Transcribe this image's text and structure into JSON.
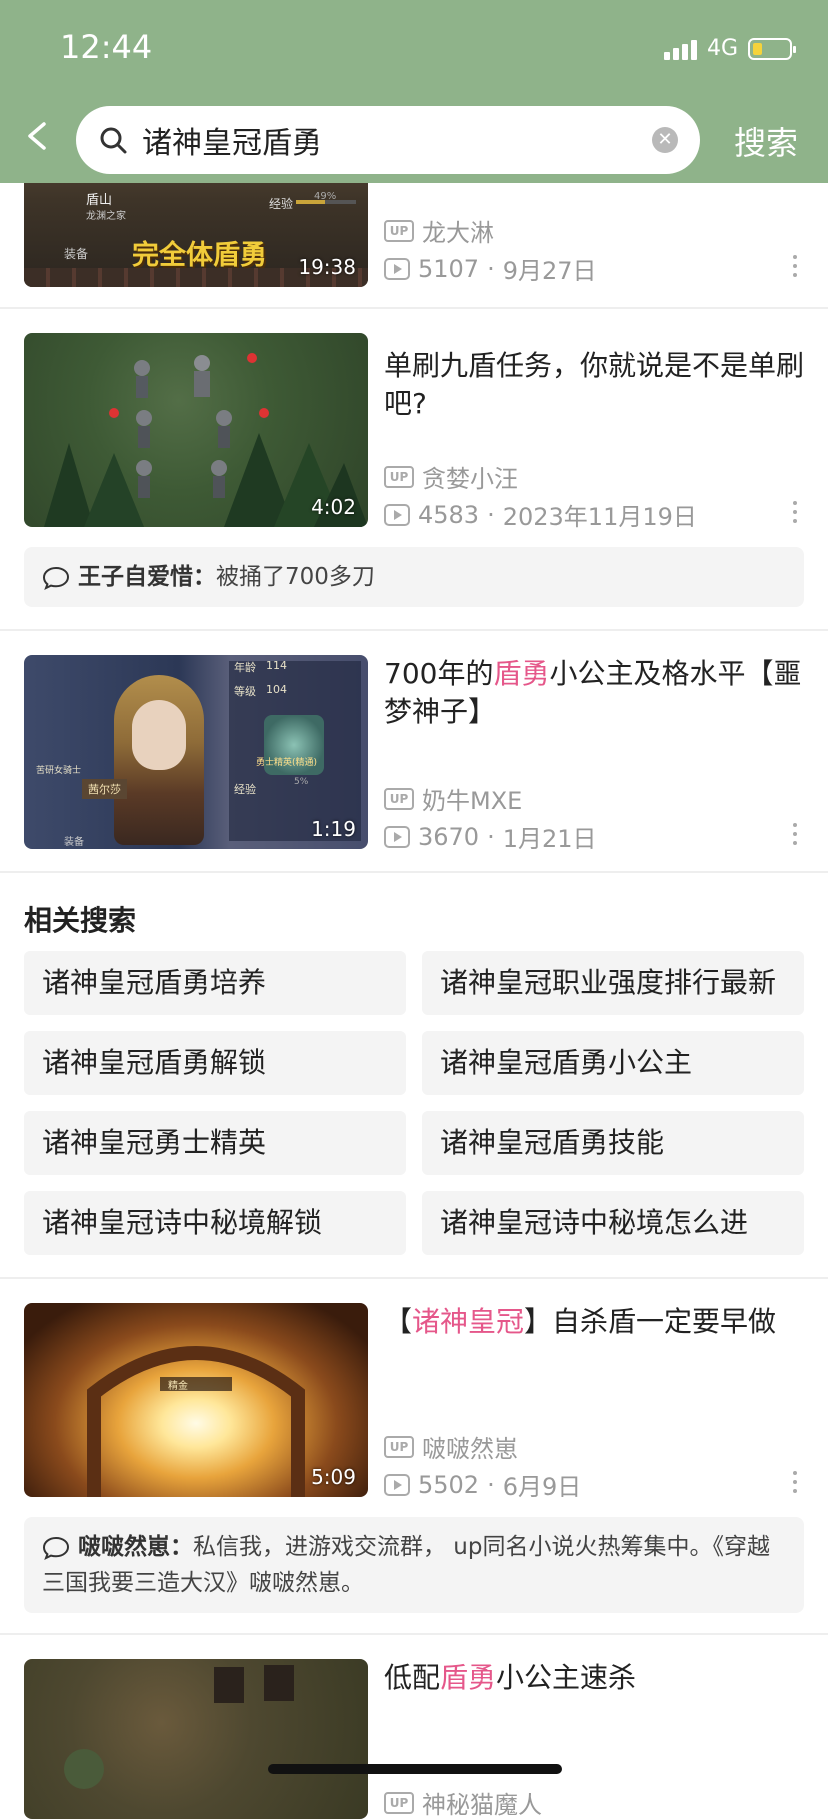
{
  "status_bar": {
    "time": "12:44",
    "network": "4G",
    "battery_level": 0.25
  },
  "search": {
    "query": "诸神皇冠盾勇",
    "clear_icon": "clear-icon",
    "search_label": "搜索",
    "back_icon": "chevron-left-icon"
  },
  "videos": [
    {
      "title_parts": [],
      "author": "龙大淋",
      "views": "5107",
      "date": "9月27日",
      "duration": "19:38",
      "thumb_overlay_text": "完全体盾勇",
      "thumb_labels": [
        "盾山",
        "龙渊之家",
        "经验",
        "49%",
        "装备"
      ]
    },
    {
      "title_parts": [
        {
          "text": "单刷九盾任务，你就说是不是单刷吧?",
          "hl": false
        }
      ],
      "author": "贪婪小汪",
      "views": "4583",
      "date": "2023年11月19日",
      "duration": "4:02",
      "comment": {
        "name": "王子自爱惜",
        "sep": "：",
        "text": "被捅了700多刀"
      }
    },
    {
      "title_parts": [
        {
          "text": "700年的",
          "hl": false
        },
        {
          "text": "盾勇",
          "hl": true
        },
        {
          "text": "小公主及格水平【噩梦神子】",
          "hl": false
        }
      ],
      "author": "奶牛MXE",
      "views": "3670",
      "date": "1月21日",
      "duration": "1:19",
      "thumb_labels": [
        "年龄",
        "114",
        "等级",
        "104",
        "勇士精英(精通)",
        "经验",
        "5%",
        "苦研女骑士",
        "茜尔莎",
        "装备"
      ]
    },
    {
      "title_parts": [
        {
          "text": "【",
          "hl": false
        },
        {
          "text": "诸神皇冠",
          "hl": true
        },
        {
          "text": "】自杀盾一定要早做",
          "hl": false
        }
      ],
      "author": "啵啵然崽",
      "views": "5502",
      "date": "6月9日",
      "duration": "5:09",
      "thumb_labels": [
        "精金"
      ],
      "comment": {
        "name": "啵啵然崽",
        "sep": "：",
        "text": "私信我，进游戏交流群， up同名小说火热筹集中。《穿越三国我要三造大汉》啵啵然崽。"
      }
    },
    {
      "title_parts": [
        {
          "text": "低配",
          "hl": false
        },
        {
          "text": "盾勇",
          "hl": true
        },
        {
          "text": "小公主速杀",
          "hl": false
        }
      ],
      "author": "神秘猫魔人",
      "views": "",
      "date": "",
      "duration": ""
    }
  ],
  "related": {
    "title": "相关搜索",
    "items": [
      "诸神皇冠盾勇培养",
      "诸神皇冠职业强度排行最新",
      "诸神皇冠盾勇解锁",
      "诸神皇冠盾勇小公主",
      "诸神皇冠勇士精英",
      "诸神皇冠盾勇技能",
      "诸神皇冠诗中秘境解锁",
      "诸神皇冠诗中秘境怎么进"
    ]
  },
  "colors": {
    "header_bg": "#8fb38a",
    "highlight": "#e5578a",
    "chip_bg": "#f4f4f4"
  }
}
